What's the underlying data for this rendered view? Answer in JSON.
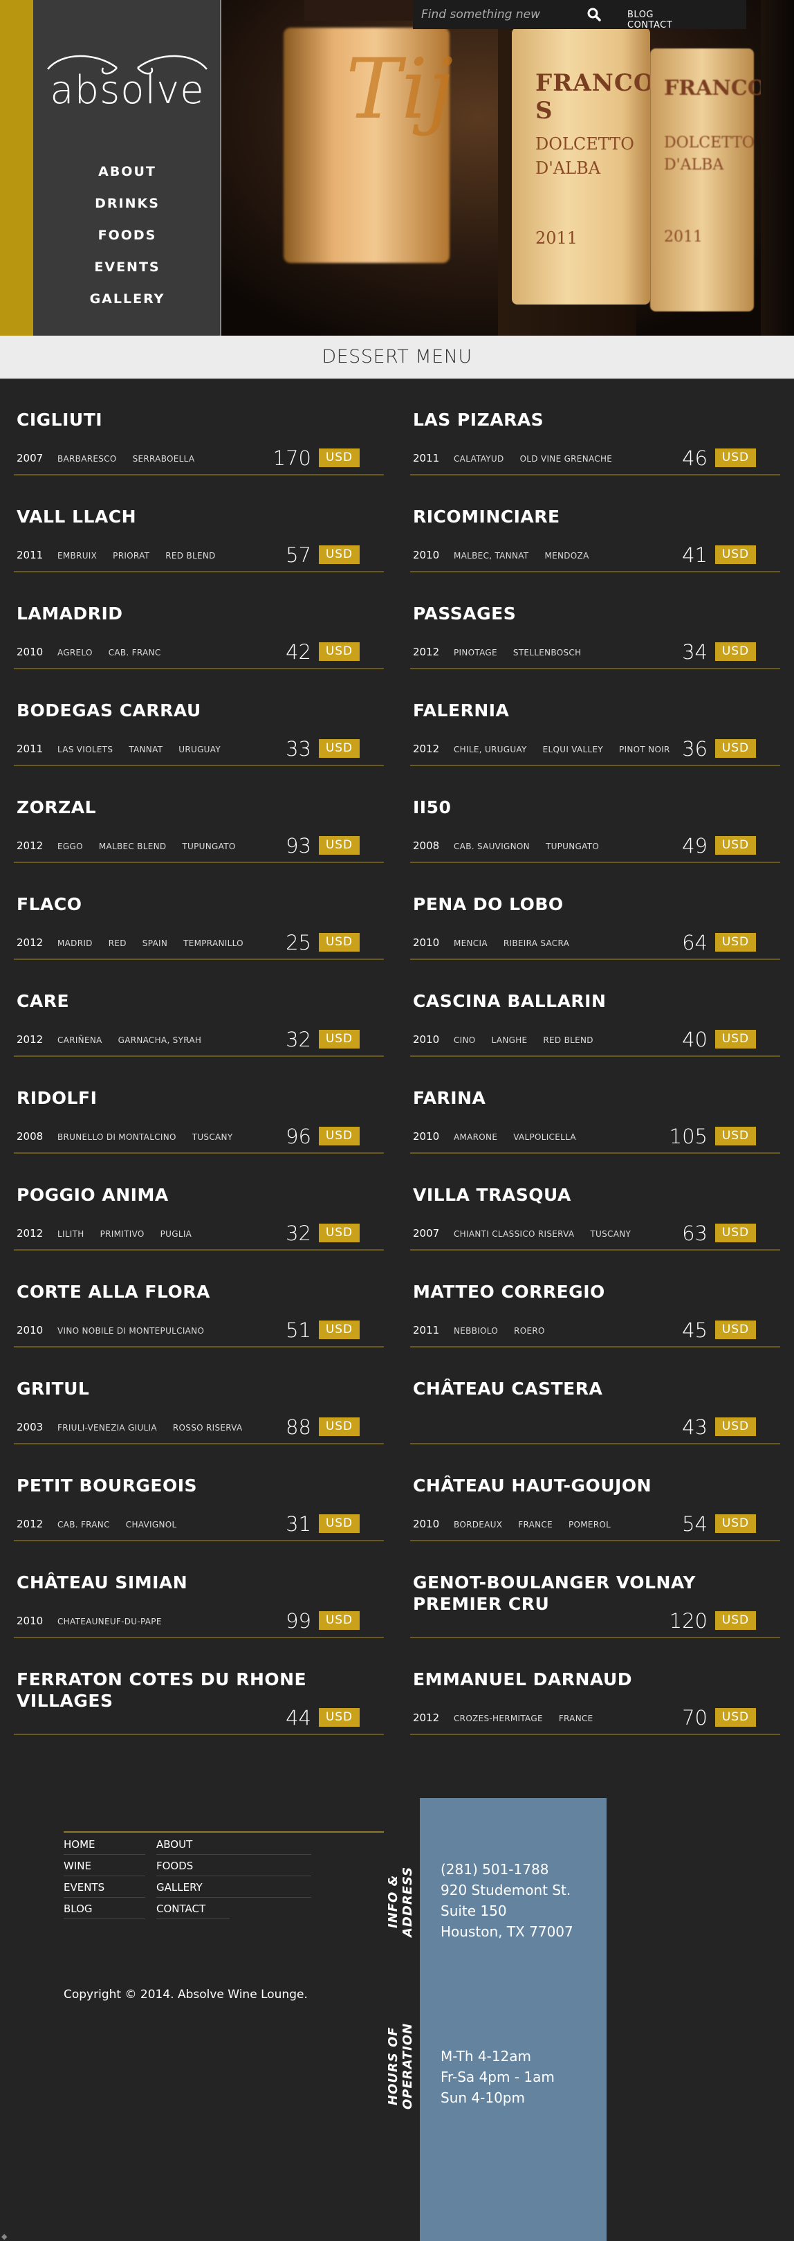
{
  "site": {
    "logo_text": "absolve",
    "search": {
      "placeholder": "Find something new"
    },
    "top_links": [
      "BLOG",
      "CONTACT"
    ],
    "main_nav": [
      "ABOUT",
      "DRINKS",
      "FOODS",
      "EVENTS",
      "GALLERY"
    ],
    "hero": {
      "label_a": "Tij",
      "label_b_title": "FRANCO S",
      "label_b_sub1": "DOLCETTO",
      "label_b_sub2": "D'ALBA",
      "label_b_year": "2011",
      "label_c_title": "FRANCO",
      "label_c_sub1": "DOLCETTO",
      "label_c_sub2": "D'ALBA",
      "label_c_year": "2011"
    }
  },
  "menu_title": "DESSERT MENU",
  "wines": [
    {
      "name": "CIGLIUTI",
      "year": "2007",
      "tags": [
        "BARBARESCO",
        "SERRABOELLA"
      ],
      "price": "170",
      "currency": "USD"
    },
    {
      "name": "LAS PIZARAS",
      "year": "2011",
      "tags": [
        "CALATAYUD",
        "OLD VINE GRENACHE"
      ],
      "price": "46",
      "currency": "USD"
    },
    {
      "name": "VALL LLACH",
      "year": "2011",
      "tags": [
        "EMBRUIX",
        "PRIORAT",
        "RED BLEND"
      ],
      "price": "57",
      "currency": "USD"
    },
    {
      "name": "RICOMINCIARE",
      "year": "2010",
      "tags": [
        "MALBEC, TANNAT",
        "MENDOZA"
      ],
      "price": "41",
      "currency": "USD"
    },
    {
      "name": "LAMADRID",
      "year": "2010",
      "tags": [
        "AGRELO",
        "CAB. FRANC"
      ],
      "price": "42",
      "currency": "USD"
    },
    {
      "name": "PASSAGES",
      "year": "2012",
      "tags": [
        "PINOTAGE",
        "STELLENBOSCH"
      ],
      "price": "34",
      "currency": "USD"
    },
    {
      "name": "BODEGAS CARRAU",
      "year": "2011",
      "tags": [
        "LAS VIOLETS",
        "TANNAT",
        "URUGUAY"
      ],
      "price": "33",
      "currency": "USD"
    },
    {
      "name": "FALERNIA",
      "year": "2012",
      "tags": [
        "CHILE, URUGUAY",
        "ELQUI VALLEY",
        "PINOT NOIR"
      ],
      "price": "36",
      "currency": "USD"
    },
    {
      "name": "ZORZAL",
      "year": "2012",
      "tags": [
        "EGGO",
        "MALBEC BLEND",
        "TUPUNGATO"
      ],
      "price": "93",
      "currency": "USD"
    },
    {
      "name": "II50",
      "year": "2008",
      "tags": [
        "CAB. SAUVIGNON",
        "TUPUNGATO"
      ],
      "price": "49",
      "currency": "USD"
    },
    {
      "name": "FLACO",
      "year": "2012",
      "tags": [
        "MADRID",
        "RED",
        "SPAIN",
        "TEMPRANILLO"
      ],
      "price": "25",
      "currency": "USD"
    },
    {
      "name": "PENA DO LOBO",
      "year": "2010",
      "tags": [
        "MENCIA",
        "RIBEIRA SACRA"
      ],
      "price": "64",
      "currency": "USD"
    },
    {
      "name": "CARE",
      "year": "2012",
      "tags": [
        "CARIÑENA",
        "GARNACHA, SYRAH"
      ],
      "price": "32",
      "currency": "USD"
    },
    {
      "name": "CASCINA BALLARIN",
      "year": "2010",
      "tags": [
        "CINO",
        "LANGHE",
        "RED BLEND"
      ],
      "price": "40",
      "currency": "USD"
    },
    {
      "name": "RIDOLFI",
      "year": "2008",
      "tags": [
        "BRUNELLO DI MONTALCINO",
        "TUSCANY"
      ],
      "price": "96",
      "currency": "USD"
    },
    {
      "name": "FARINA",
      "year": "2010",
      "tags": [
        "AMARONE",
        "VALPOLICELLA"
      ],
      "price": "105",
      "currency": "USD"
    },
    {
      "name": "POGGIO ANIMA",
      "year": "2012",
      "tags": [
        "LILITH",
        "PRIMITIVO",
        "PUGLIA"
      ],
      "price": "32",
      "currency": "USD"
    },
    {
      "name": "VILLA TRASQUA",
      "year": "2007",
      "tags": [
        "CHIANTI CLASSICO RISERVA",
        "TUSCANY"
      ],
      "price": "63",
      "currency": "USD"
    },
    {
      "name": "CORTE ALLA FLORA",
      "year": "2010",
      "tags": [
        "VINO NOBILE DI MONTEPULCIANO"
      ],
      "price": "51",
      "currency": "USD"
    },
    {
      "name": "MATTEO CORREGIO",
      "year": "2011",
      "tags": [
        "NEBBIOLO",
        "ROERO"
      ],
      "price": "45",
      "currency": "USD"
    },
    {
      "name": "GRITUL",
      "year": "2003",
      "tags": [
        "FRIULI-VENEZIA GIULIA",
        "ROSSO RISERVA"
      ],
      "price": "88",
      "currency": "USD"
    },
    {
      "name": "CHÂTEAU CASTERA",
      "year": "",
      "tags": [],
      "price": "43",
      "currency": "USD"
    },
    {
      "name": "PETIT BOURGEOIS",
      "year": "2012",
      "tags": [
        "CAB. FRANC",
        "CHAVIGNOL"
      ],
      "price": "31",
      "currency": "USD"
    },
    {
      "name": "CHÂTEAU HAUT-GOUJON",
      "year": "2010",
      "tags": [
        "BORDEAUX",
        "FRANCE",
        "POMEROL"
      ],
      "price": "54",
      "currency": "USD"
    },
    {
      "name": "CHÂTEAU SIMIAN",
      "year": "2010",
      "tags": [
        "CHATEAUNEUF-DU-PAPE"
      ],
      "price": "99",
      "currency": "USD"
    },
    {
      "name": "GENOT-BOULANGER VOLNAY PREMIER CRU",
      "year": "",
      "tags": [],
      "price": "120",
      "currency": "USD"
    },
    {
      "name": "FERRATON COTES DU RHONE VILLAGES",
      "year": "",
      "tags": [],
      "price": "44",
      "currency": "USD"
    },
    {
      "name": "EMMANUEL DARNAUD",
      "year": "2012",
      "tags": [
        "CROZES-HERMITAGE",
        "FRANCE"
      ],
      "price": "70",
      "currency": "USD"
    }
  ],
  "footer": {
    "nav_col1": [
      "HOME",
      "WINE",
      "EVENTS",
      "BLOG"
    ],
    "nav_col2": [
      "ABOUT",
      "FOODS",
      "GALLERY",
      "CONTACT"
    ],
    "copyright": "Copyright © 2014. Absolve Wine Lounge.",
    "info_heading": "INFO & ADDRESS",
    "hours_heading": "HOURS OF OPERATION",
    "phone": "(281) 501-1788",
    "street": "920 Studemont St.",
    "suite": "Suite 150",
    "city": "Houston, TX 77007",
    "hours": [
      "M-Th 4-12am",
      "Fr-Sa 4pm - 1am",
      "Sun 4-10pm"
    ]
  },
  "colors": {
    "gold": "#c9a11b",
    "panel": "#3a3a3a",
    "info_blue": "#63839e",
    "bg": "#242424"
  }
}
